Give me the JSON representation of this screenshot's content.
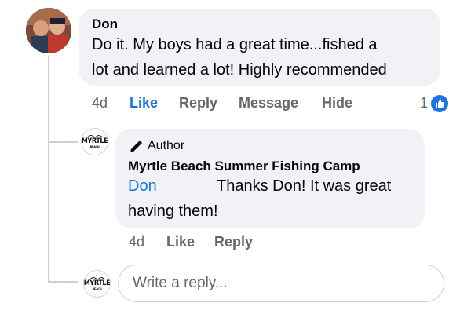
{
  "comment": {
    "author_name": "Don",
    "text_lines": [
      "Do it. My boys had a great time...fished a",
      "lot and learned a lot! Highly recommended"
    ],
    "age": "4d",
    "like_label": "Like",
    "reply_label": "Reply",
    "message_label": "Message",
    "hide_label": "Hide",
    "reaction_count": "1",
    "like_color": "#1a73e8"
  },
  "reply": {
    "badge_label": "Author",
    "author_name": "Myrtle Beach Summer Fishing Camp",
    "mention": "Don",
    "text_line1": "Thanks Don! It was great",
    "text_line2": "having them!",
    "age": "4d",
    "like_label": "Like",
    "reply_label": "Reply",
    "page_logo_text_1": "MYRTLE",
    "page_logo_text_2": "BEACH"
  },
  "composer": {
    "placeholder": "Write a reply..."
  },
  "icons": {
    "author_badge": "pencil-icon",
    "reaction": "thumbs-up-icon"
  }
}
